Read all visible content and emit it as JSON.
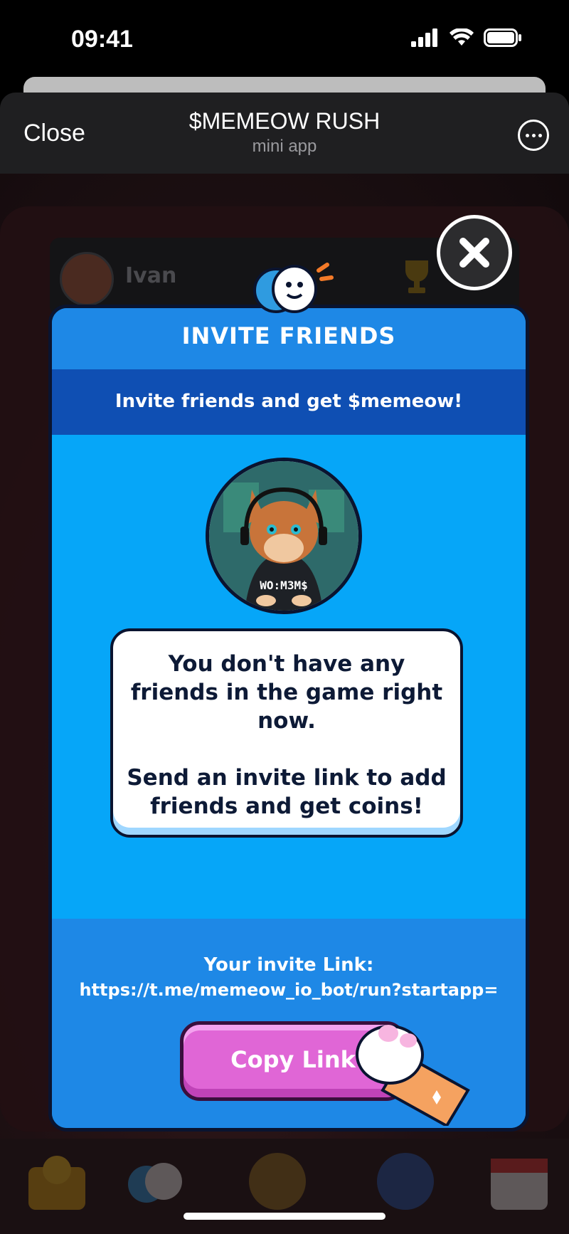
{
  "status_bar": {
    "time": "09:41"
  },
  "header": {
    "close_label": "Close",
    "title": "$MEMEOW RUSH",
    "subtitle": "mini app"
  },
  "background": {
    "player_name": "Ivan"
  },
  "modal": {
    "title": "INVITE FRIENDS",
    "subtitle": "Invite friends and get $memeow!",
    "avatar_text": "WO:M3M$",
    "message": "You don't have any\nfriends in the game right\nnow.\n\nSend an invite link to add\nfriends and get coins!",
    "invite_label": "Your invite Link:",
    "invite_url": "https://t.me/memeow_io_bot/run?startapp=",
    "copy_button_label": "Copy Link"
  },
  "colors": {
    "modal_bg": "#06a6f8",
    "header_bg": "#1e88e6",
    "subheader_bg": "#0f4fb3",
    "copy_button": "#e066d6"
  }
}
